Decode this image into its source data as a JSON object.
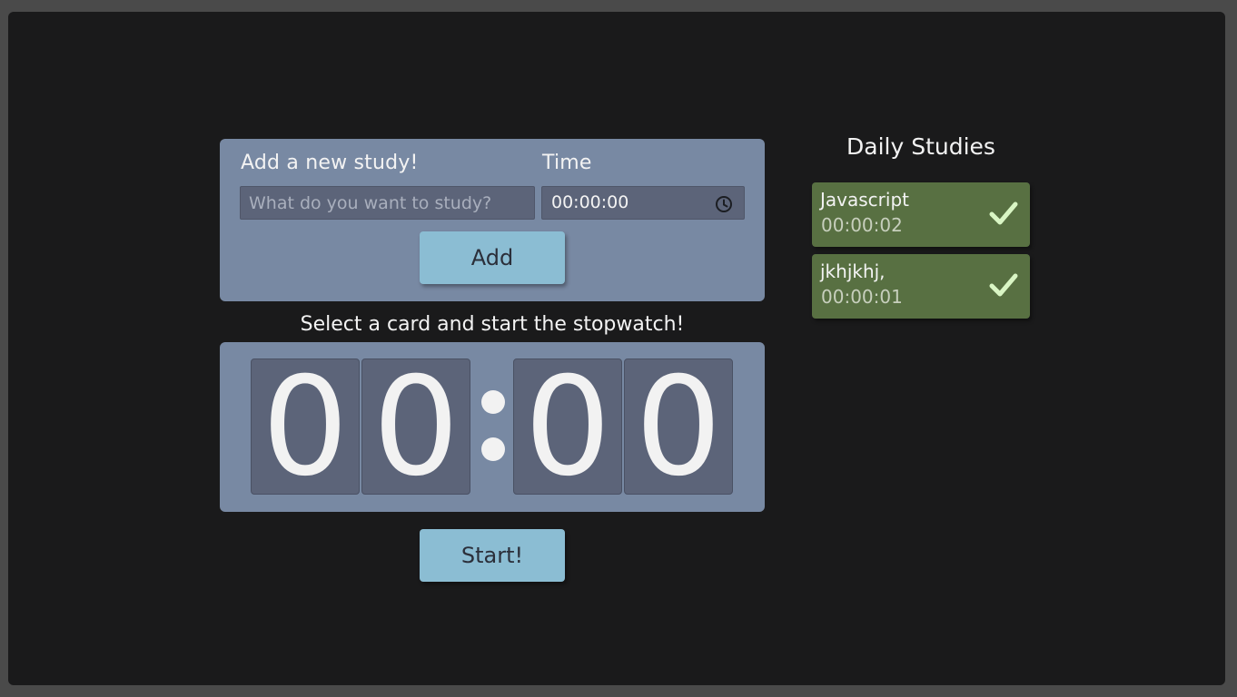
{
  "add_form": {
    "study_label": "Add a new study!",
    "time_label": "Time",
    "study_placeholder": "What do you want to study?",
    "time_value": "00:00:00",
    "add_button": "Add"
  },
  "stopwatch": {
    "instruction": "Select a card and start the stopwatch!",
    "digits": [
      "0",
      "0",
      "0",
      "0"
    ],
    "start_button": "Start!"
  },
  "daily": {
    "title": "Daily Studies",
    "items": [
      {
        "name": "Javascript",
        "time": "00:00:02",
        "icon": "check-icon"
      },
      {
        "name": "jkhjkhj,",
        "time": "00:00:01",
        "icon": "check-icon"
      }
    ]
  },
  "colors": {
    "background": "#1a1a1b",
    "panel": "#7889a3",
    "input": "#5c6479",
    "button": "#8bbdd3",
    "card": "#587042",
    "check": "#d9f5c4"
  }
}
